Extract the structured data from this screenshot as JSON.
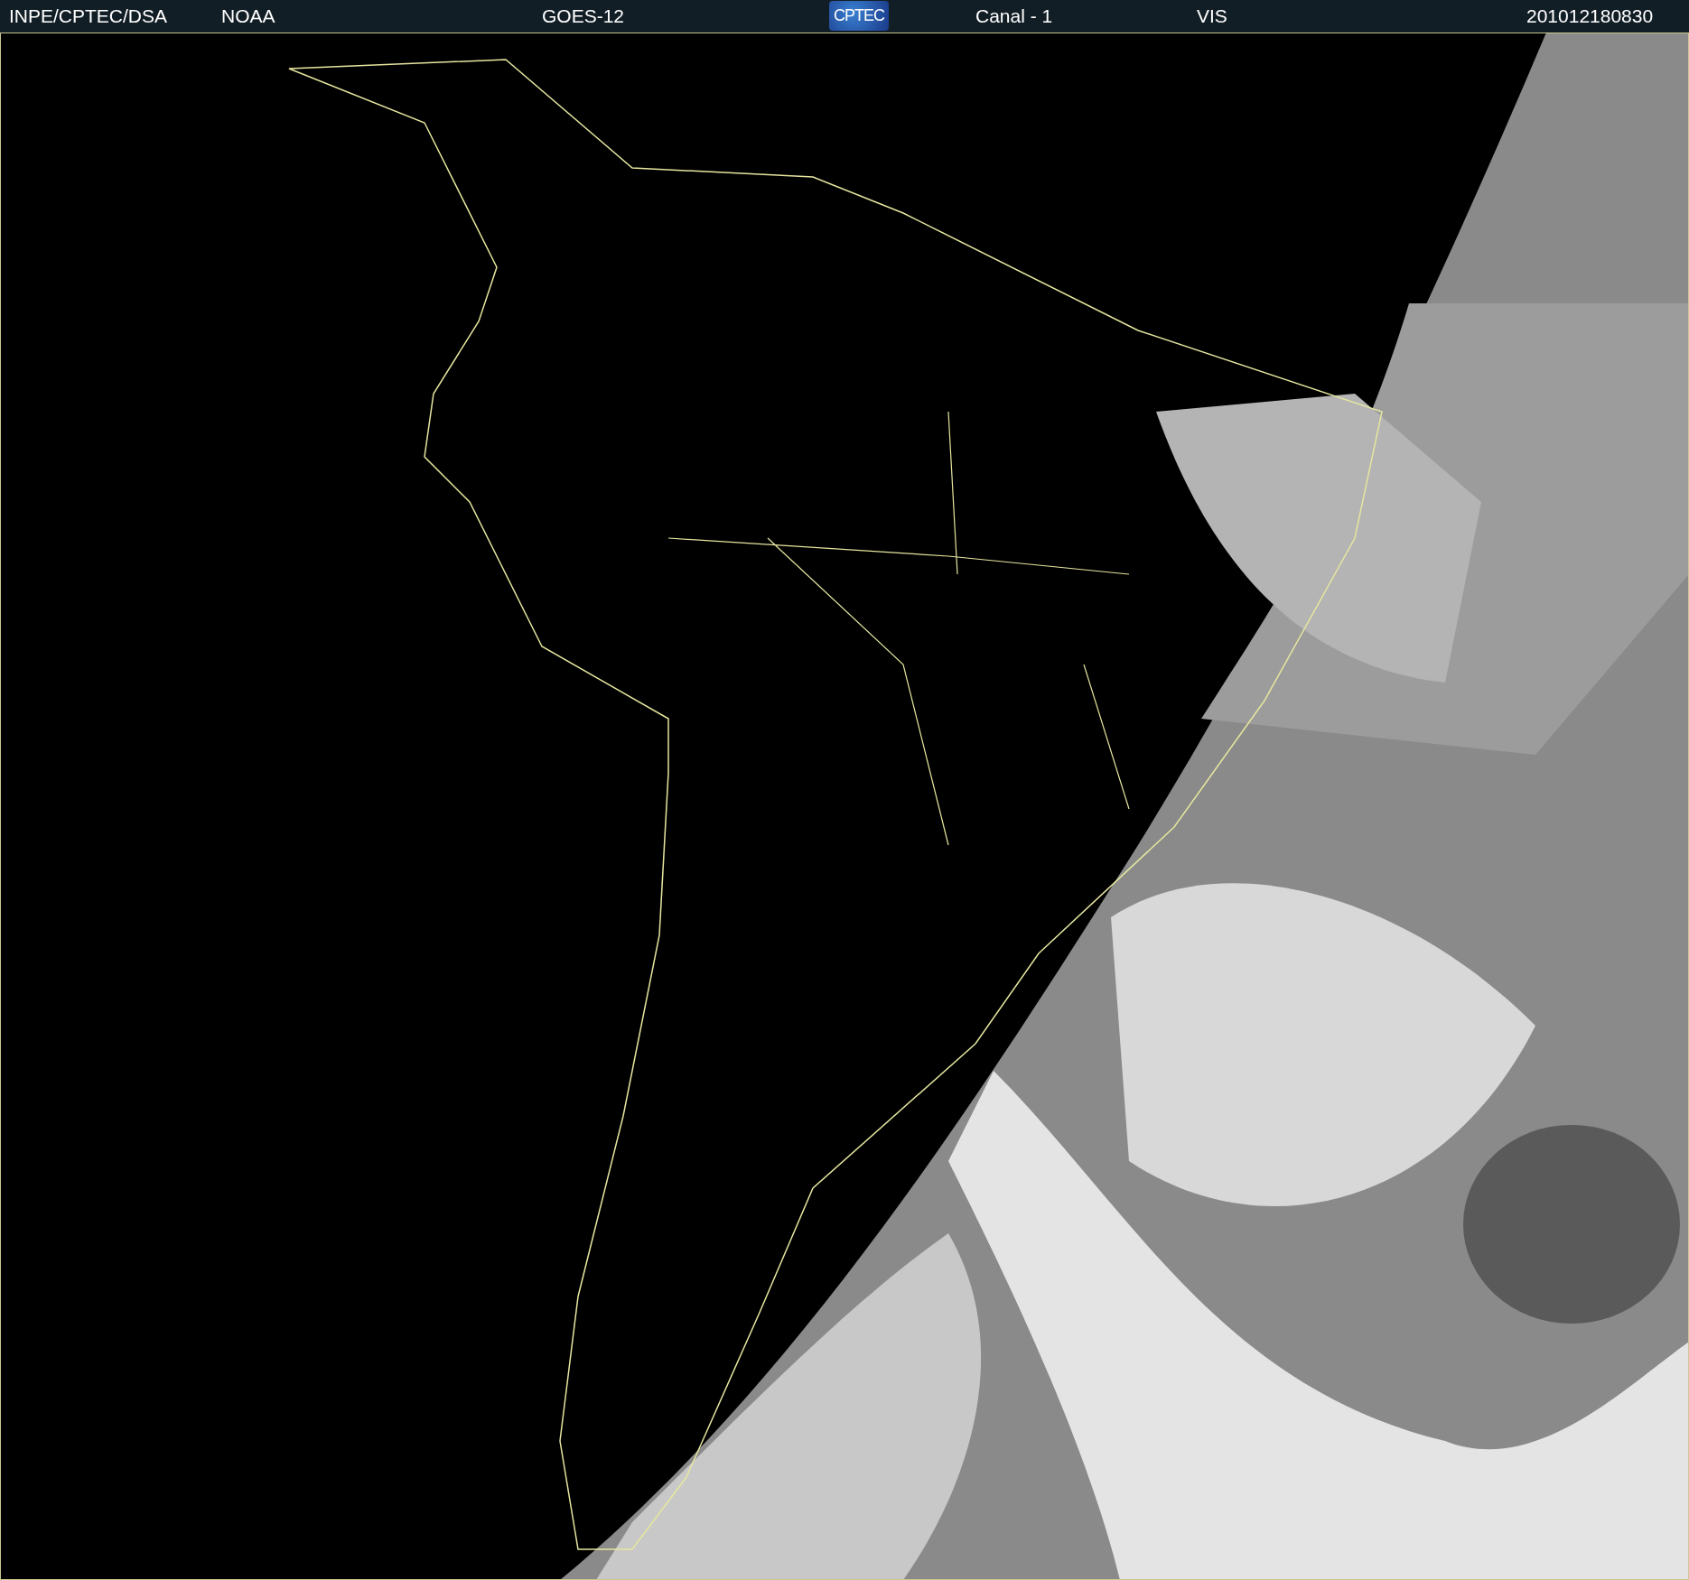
{
  "header": {
    "items": [
      {
        "kind": "text",
        "text": "INPE/CPTEC/DSA"
      },
      {
        "kind": "text",
        "text": "NOAA"
      },
      {
        "kind": "text",
        "text": "GOES-12"
      },
      {
        "kind": "logo",
        "text": "CPTEC"
      },
      {
        "kind": "text",
        "text": "Canal - 1"
      },
      {
        "kind": "text",
        "text": "VIS"
      },
      {
        "kind": "text",
        "text": "201012180830"
      }
    ]
  }
}
